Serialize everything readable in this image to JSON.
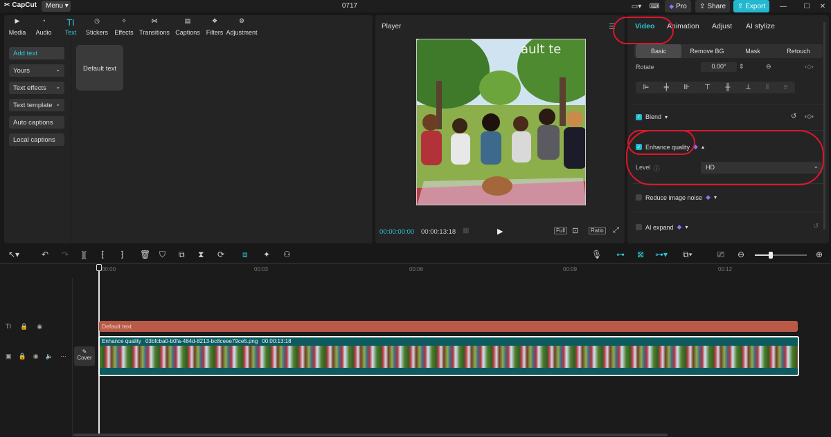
{
  "app": {
    "name": "CapCut",
    "menu_label": "Menu",
    "project_name": "0717"
  },
  "titlebar": {
    "pro_label": "Pro",
    "share_label": "Share",
    "export_label": "Export",
    "accent": "#22b8cf"
  },
  "left_tabs": [
    {
      "label": "Media",
      "icon": "media-icon"
    },
    {
      "label": "Audio",
      "icon": "audio-icon"
    },
    {
      "label": "Text",
      "icon": "text-icon",
      "active": true
    },
    {
      "label": "Stickers",
      "icon": "stickers-icon"
    },
    {
      "label": "Effects",
      "icon": "effects-icon"
    },
    {
      "label": "Transitions",
      "icon": "transitions-icon"
    },
    {
      "label": "Captions",
      "icon": "captions-icon"
    },
    {
      "label": "Filters",
      "icon": "filters-icon"
    },
    {
      "label": "Adjustment",
      "icon": "adjustment-icon"
    }
  ],
  "text_sidebar": [
    "Add text",
    "Yours",
    "Text effects",
    "Text template",
    "Auto captions",
    "Local captions"
  ],
  "default_text_tile": "Default text",
  "player": {
    "title": "Player",
    "current_time": "00:00:00:00",
    "duration": "00:00:13:18",
    "full_label": "Full",
    "ratio_label": "Ratio"
  },
  "right_tabs": [
    "Video",
    "Animation",
    "Adjust",
    "AI stylize"
  ],
  "sub_tabs": [
    "Basic",
    "Remove BG",
    "Mask",
    "Retouch"
  ],
  "rotate": {
    "label": "Rotate",
    "value": "0.00°"
  },
  "blend_label": "Blend",
  "enhance": {
    "label": "Enhance quality",
    "level_label": "Level",
    "level_value": "HD",
    "checked": true
  },
  "reduce_noise_label": "Reduce image noise",
  "ai_expand_label": "AI expand",
  "timeline": {
    "ruler": [
      "00:00",
      "00:03",
      "00:06",
      "00:09",
      "00:12"
    ],
    "text_clip": "Default text",
    "video_clip_effect": "Enhance quality",
    "video_clip_name": "03bfcba0-b0fa-484d-8213-bc8ceee79ce5.png",
    "video_clip_duration": "00:00:13:18",
    "cover_label": "Cover"
  }
}
